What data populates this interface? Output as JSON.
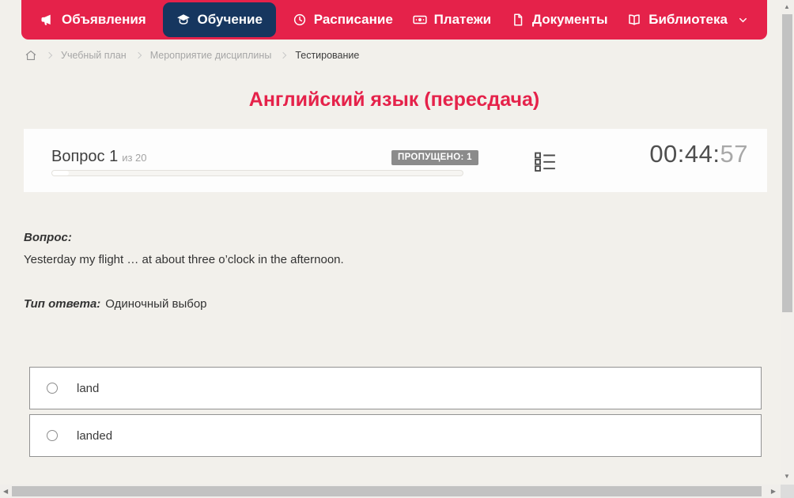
{
  "nav": {
    "items": [
      {
        "label": "Объявления",
        "icon": "megaphone-icon",
        "active": false
      },
      {
        "label": "Обучение",
        "icon": "graduation-cap-icon",
        "active": true
      },
      {
        "label": "Расписание",
        "icon": "clock-icon",
        "active": false
      },
      {
        "label": "Платежи",
        "icon": "banknote-icon",
        "active": false
      },
      {
        "label": "Документы",
        "icon": "document-icon",
        "active": false
      },
      {
        "label": "Библиотека",
        "icon": "book-icon",
        "active": false,
        "has_dropdown": true
      }
    ]
  },
  "breadcrumb": {
    "home_icon": "home-icon",
    "items": [
      "Учебный план",
      "Мероприятие дисциплины",
      "Тестирование"
    ]
  },
  "page_title": "Английский язык (пересдача)",
  "question_header": {
    "question_label": "Вопрос 1",
    "question_total": "из 20",
    "progress_percent": 4,
    "skipped_badge": "ПРОПУЩЕНО: 1",
    "questions_list_icon": "question-list-icon",
    "timer_main": "00:44:",
    "timer_seconds": "57"
  },
  "question": {
    "label": "Вопрос:",
    "text": "Yesterday my flight … at about three o’clock in the afternoon.",
    "type_label": "Тип ответа:",
    "type_value": "Одиночный выбор"
  },
  "options": [
    {
      "label": "land",
      "selected": false
    },
    {
      "label": "landed",
      "selected": false
    }
  ],
  "scrollbars": {
    "up": "▲",
    "down": "▼",
    "left": "◀",
    "right": "▶"
  },
  "colors": {
    "nav_red": "#e5224a",
    "active_navy": "#16365f",
    "page_bg": "#f2f0eb",
    "title_red": "#e5224a",
    "badge_gray": "#8b8b8b"
  }
}
